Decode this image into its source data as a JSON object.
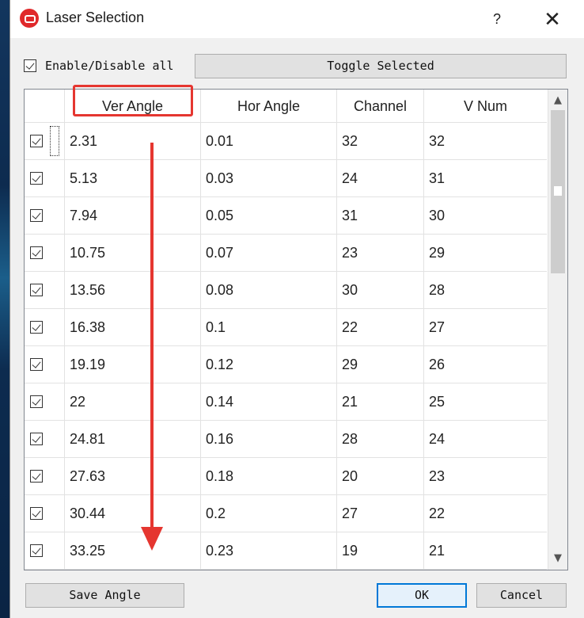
{
  "window": {
    "title": "Laser Selection",
    "help_label": "?",
    "close_label": "✕"
  },
  "controls": {
    "enable_all_label": "Enable/Disable all",
    "enable_all_checked": true,
    "toggle_selected_label": "Toggle Selected"
  },
  "table": {
    "columns": [
      "Ver Angle",
      "Hor Angle",
      "Channel",
      "V Num"
    ],
    "sort_indicator": "^",
    "rows": [
      {
        "checked": true,
        "ver_angle": "2.31",
        "hor_angle": "0.01",
        "channel": "32",
        "v_num": "32"
      },
      {
        "checked": true,
        "ver_angle": "5.13",
        "hor_angle": "0.03",
        "channel": "24",
        "v_num": "31"
      },
      {
        "checked": true,
        "ver_angle": "7.94",
        "hor_angle": "0.05",
        "channel": "31",
        "v_num": "30"
      },
      {
        "checked": true,
        "ver_angle": "10.75",
        "hor_angle": "0.07",
        "channel": "23",
        "v_num": "29"
      },
      {
        "checked": true,
        "ver_angle": "13.56",
        "hor_angle": "0.08",
        "channel": "30",
        "v_num": "28"
      },
      {
        "checked": true,
        "ver_angle": "16.38",
        "hor_angle": "0.1",
        "channel": "22",
        "v_num": "27"
      },
      {
        "checked": true,
        "ver_angle": "19.19",
        "hor_angle": "0.12",
        "channel": "29",
        "v_num": "26"
      },
      {
        "checked": true,
        "ver_angle": "22",
        "hor_angle": "0.14",
        "channel": "21",
        "v_num": "25"
      },
      {
        "checked": true,
        "ver_angle": "24.81",
        "hor_angle": "0.16",
        "channel": "28",
        "v_num": "24"
      },
      {
        "checked": true,
        "ver_angle": "27.63",
        "hor_angle": "0.18",
        "channel": "20",
        "v_num": "23"
      },
      {
        "checked": true,
        "ver_angle": "30.44",
        "hor_angle": "0.2",
        "channel": "27",
        "v_num": "22"
      },
      {
        "checked": true,
        "ver_angle": "33.25",
        "hor_angle": "0.23",
        "channel": "19",
        "v_num": "21"
      }
    ]
  },
  "footer": {
    "save_label": "Save Angle",
    "ok_label": "OK",
    "cancel_label": "Cancel"
  },
  "annotation": {
    "color": "#e53630"
  },
  "icons": {
    "app": "app-logo-icon",
    "scroll_up": "chevron-up-icon",
    "scroll_down": "chevron-down-icon"
  }
}
